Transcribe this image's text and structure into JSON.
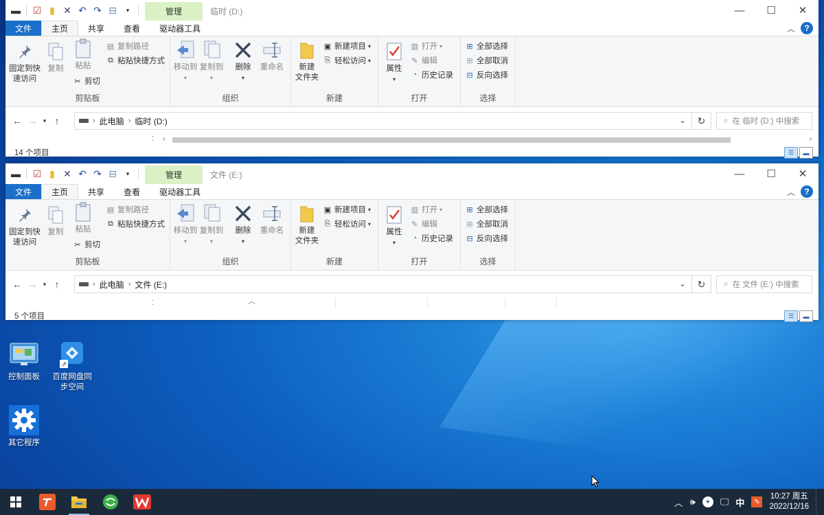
{
  "windows": [
    {
      "title": "临时 (D:)",
      "manage_tab": "管理",
      "tabs": [
        "文件",
        "主页",
        "共享",
        "查看",
        "驱动器工具"
      ],
      "ribbon": {
        "pin_label": "固定到快速访问",
        "copy": "复制",
        "paste": "粘贴",
        "copy_path": "复制路径",
        "paste_shortcut": "粘贴快捷方式",
        "cut": "剪切",
        "clipboard_group": "剪贴板",
        "move_to": "移动到",
        "copy_to": "复制到",
        "delete": "删除",
        "rename": "重命名",
        "organize_group": "组织",
        "new_folder_l1": "新建",
        "new_folder_l2": "文件夹",
        "new_item": "新建项目",
        "easy_access": "轻松访问",
        "new_group": "新建",
        "properties": "属性",
        "open": "打开",
        "edit": "编辑",
        "history": "历史记录",
        "open_group": "打开",
        "select_all": "全部选择",
        "select_none": "全部取消",
        "invert_selection": "反向选择",
        "select_group": "选择"
      },
      "path": [
        "此电脑",
        "临时 (D:)"
      ],
      "search_placeholder": "在 临时 (D:) 中搜索",
      "status": "14 个项目"
    },
    {
      "title": "文件 (E:)",
      "manage_tab": "管理",
      "tabs": [
        "文件",
        "主页",
        "共享",
        "查看",
        "驱动器工具"
      ],
      "ribbon": {
        "pin_label": "固定到快速访问",
        "copy": "复制",
        "paste": "粘贴",
        "copy_path": "复制路径",
        "paste_shortcut": "粘贴快捷方式",
        "cut": "剪切",
        "clipboard_group": "剪贴板",
        "move_to": "移动到",
        "copy_to": "复制到",
        "delete": "删除",
        "rename": "重命名",
        "organize_group": "组织",
        "new_folder_l1": "新建",
        "new_folder_l2": "文件夹",
        "new_item": "新建项目",
        "easy_access": "轻松访问",
        "new_group": "新建",
        "properties": "属性",
        "open": "打开",
        "edit": "编辑",
        "history": "历史记录",
        "open_group": "打开",
        "select_all": "全部选择",
        "select_none": "全部取消",
        "invert_selection": "反向选择",
        "select_group": "选择"
      },
      "path": [
        "此电脑",
        "文件 (E:)"
      ],
      "search_placeholder": "在 文件 (E:) 中搜索",
      "status": "5 个项目"
    }
  ],
  "desktop": {
    "icons": [
      {
        "label": "控制面板",
        "icon": "control-panel-icon"
      },
      {
        "label": "百度网盘同步空间",
        "icon": "baidu-netdisk-sync-icon"
      },
      {
        "label": "其它程序",
        "icon": "gear-icon"
      }
    ]
  },
  "taskbar": {
    "ime": "中",
    "time": "10:27 周五",
    "date": "2022/12/16"
  },
  "colors": {
    "ribbon_file_tab": "#1a6fc9",
    "manage_tab": "#d9f1c4",
    "taskbar": "#1b2a3a"
  }
}
